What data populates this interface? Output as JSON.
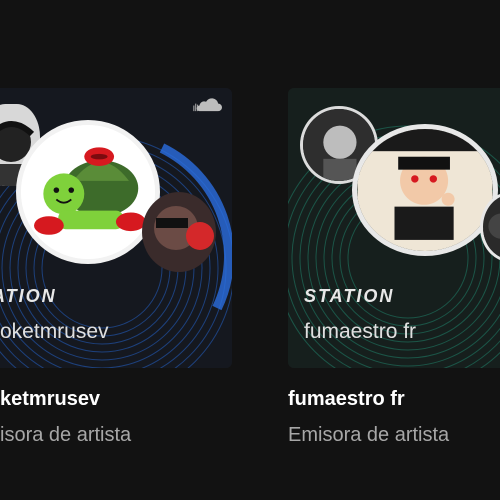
{
  "cards": [
    {
      "station_label": "ATION",
      "station_artist": "oketmrusev",
      "title": "ketmrusev",
      "subtitle": "isora de artista",
      "ring_color": "#2563c9",
      "tile_color": "#161a24"
    },
    {
      "station_label": "STATION",
      "station_artist": "fumaestro fr",
      "title": "fumaestro fr",
      "subtitle": "Emisora de artista",
      "ring_color": "#1f7a64",
      "tile_color": "#16201e"
    }
  ],
  "icons": {
    "source_logo": "cloud-icon"
  }
}
